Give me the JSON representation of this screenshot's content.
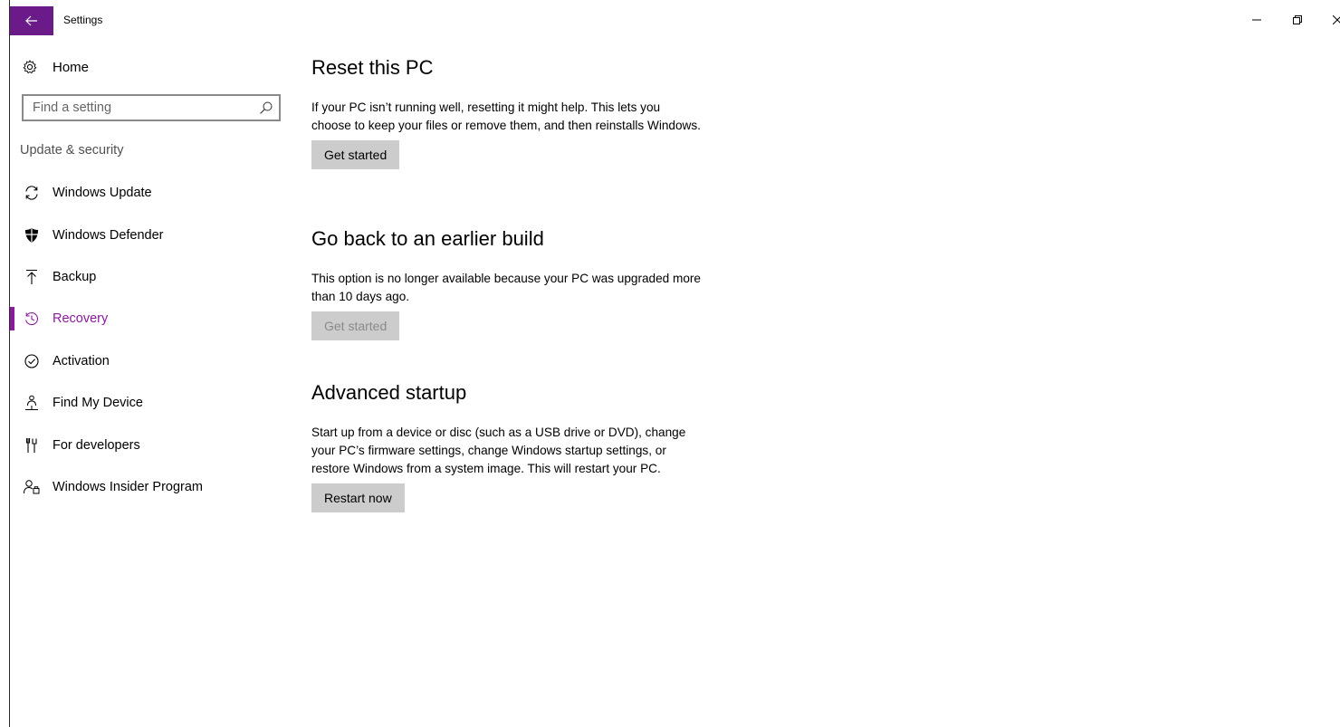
{
  "window": {
    "title": "Settings",
    "accent_color": "#6b1a8a"
  },
  "sidebar": {
    "home_label": "Home",
    "search_placeholder": "Find a setting",
    "section_label": "Update & security",
    "items": [
      {
        "label": "Windows Update",
        "icon": "sync-icon",
        "active": false
      },
      {
        "label": "Windows Defender",
        "icon": "shield-icon",
        "active": false
      },
      {
        "label": "Backup",
        "icon": "backup-arrow-icon",
        "active": false
      },
      {
        "label": "Recovery",
        "icon": "history-icon",
        "active": true
      },
      {
        "label": "Activation",
        "icon": "check-circle-icon",
        "active": false
      },
      {
        "label": "Find My Device",
        "icon": "person-location-icon",
        "active": false
      },
      {
        "label": "For developers",
        "icon": "developer-tools-icon",
        "active": false
      },
      {
        "label": "Windows Insider Program",
        "icon": "insider-icon",
        "active": false
      }
    ],
    "active_color": "#8a1a9c"
  },
  "main": {
    "reset": {
      "title": "Reset this PC",
      "description": "If your PC isn’t running well, resetting it might help. This lets you choose to keep your files or remove them, and then reinstalls Windows.",
      "button_label": "Get started"
    },
    "go_back": {
      "title": "Go back to an earlier build",
      "description": "This option is no longer available because your PC was upgraded more than 10 days ago.",
      "button_label": "Get started",
      "button_disabled": true
    },
    "advanced": {
      "title": "Advanced startup",
      "description": "Start up from a device or disc (such as a USB drive or DVD), change your PC’s firmware settings, change Windows startup settings, or restore Windows from a system image. This will restart your PC.",
      "button_label": "Restart now"
    }
  }
}
